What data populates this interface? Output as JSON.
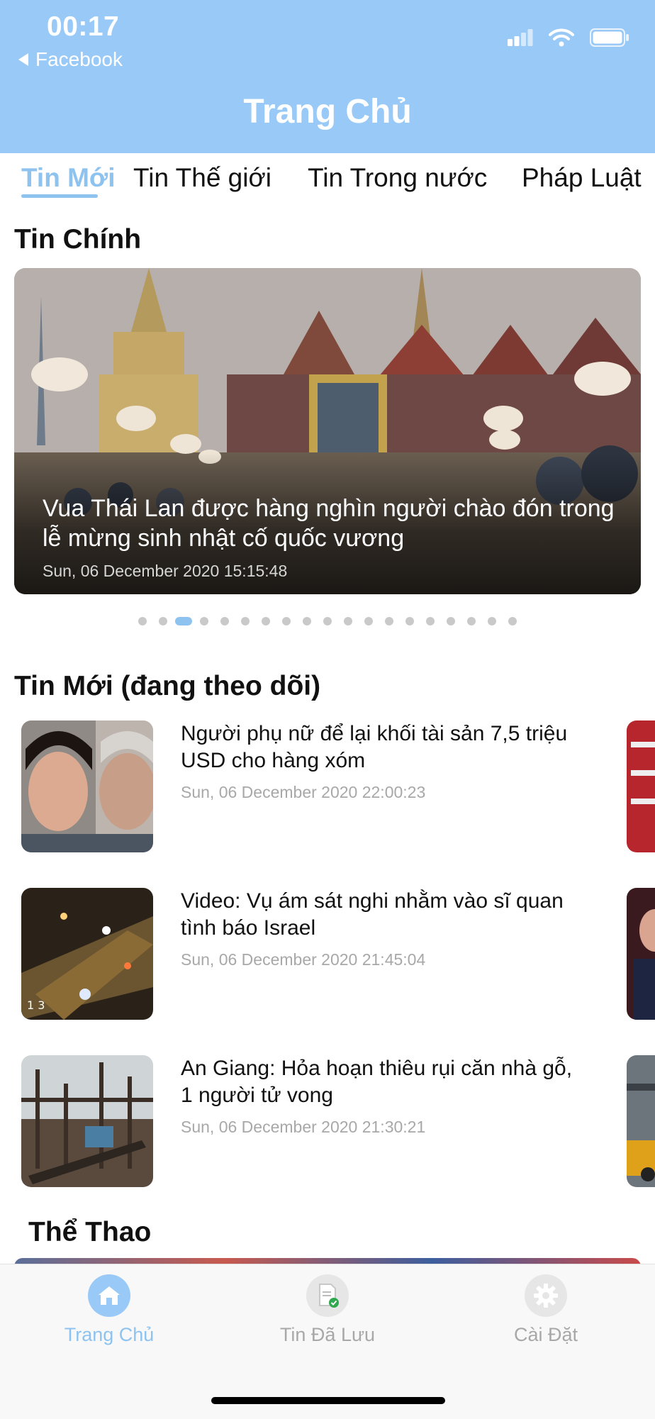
{
  "status_bar": {
    "time": "00:17",
    "back_app": "Facebook",
    "icons": [
      "signal-icon",
      "wifi-icon",
      "battery-icon"
    ]
  },
  "header": {
    "title": "Trang Chủ"
  },
  "tabs": [
    {
      "label": "Tin Mới",
      "active": true
    },
    {
      "label": "Tin Thế giới",
      "active": false
    },
    {
      "label": "Tin Trong nước",
      "active": false
    },
    {
      "label": "Pháp Luật",
      "active": false
    }
  ],
  "featured": {
    "section_title": "Tin Chính",
    "title": "Vua Thái Lan được hàng nghìn người chào đón trong lễ mừng sinh nhật cố quốc vương",
    "date": "Sun, 06 December 2020 15:15:48",
    "carousel": {
      "count": 19,
      "active_index": 2
    }
  },
  "following": {
    "section_title": "Tin Mới (đang theo dõi)",
    "items": [
      {
        "title": "Người phụ nữ để lại khối tài sản 7,5 triệu USD cho hàng xóm",
        "date": "Sun, 06 December 2020 22:00:23"
      },
      {
        "title": "Video: Vụ ám sát nghi nhằm vào sĩ quan tình báo Israel",
        "date": "Sun, 06 December 2020 21:45:04",
        "thumb_caption": "1 3"
      },
      {
        "title": "An Giang: Hỏa hoạn thiêu rụi căn nhà gỗ, 1 người tử vong",
        "date": "Sun, 06 December 2020 21:30:21"
      }
    ]
  },
  "sports": {
    "section_title": "Thể Thao"
  },
  "tabbar": [
    {
      "label": "Trang Chủ",
      "icon": "home-icon",
      "active": true
    },
    {
      "label": "Tin Đã Lưu",
      "icon": "saved-document-icon",
      "active": false
    },
    {
      "label": "Cài Đặt",
      "icon": "gear-icon",
      "active": false
    }
  ],
  "colors": {
    "header_bg": "#99c9f7",
    "accent": "#8ec3f0",
    "inactive": "#a8a8a8"
  }
}
